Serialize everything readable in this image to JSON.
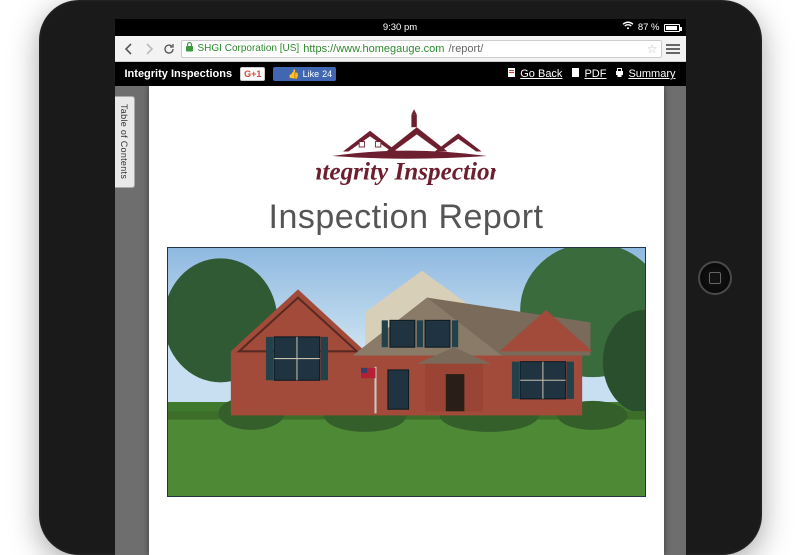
{
  "status": {
    "time": "9:30 pm",
    "battery_pct": "87 %"
  },
  "browser": {
    "corp_label": "SHGI Corporation [US]",
    "url_scheme_host": "https://www.homegauge.com",
    "url_path": "/report/"
  },
  "reportbar": {
    "brand": "Integrity Inspections",
    "gplus": "G+1",
    "like_label": "Like",
    "like_count": "24",
    "links": {
      "goback": "Go Back",
      "pdf": "PDF",
      "summary": "Summary"
    }
  },
  "sidebar": {
    "toc_label": "Table of Contents"
  },
  "page": {
    "logo_text": "Integrity Inspections",
    "title": "Inspection Report"
  }
}
